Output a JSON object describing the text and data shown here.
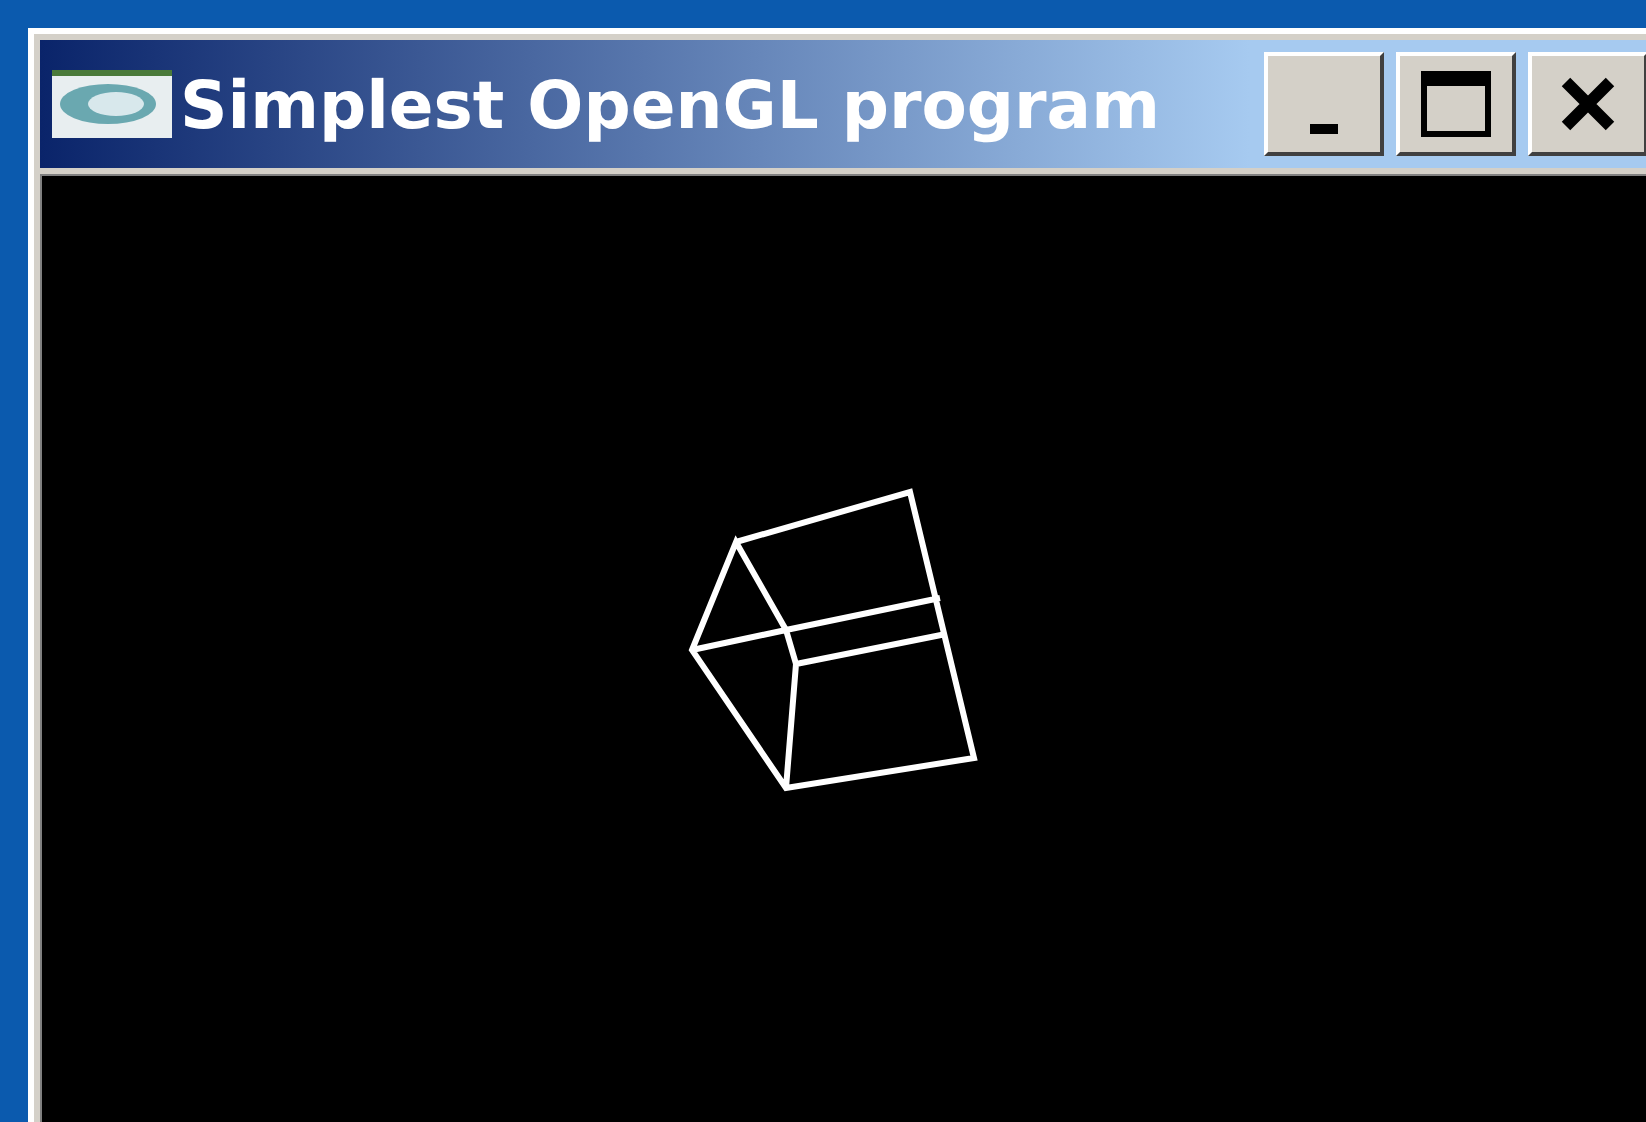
{
  "window": {
    "title": "Simplest OpenGL program"
  }
}
